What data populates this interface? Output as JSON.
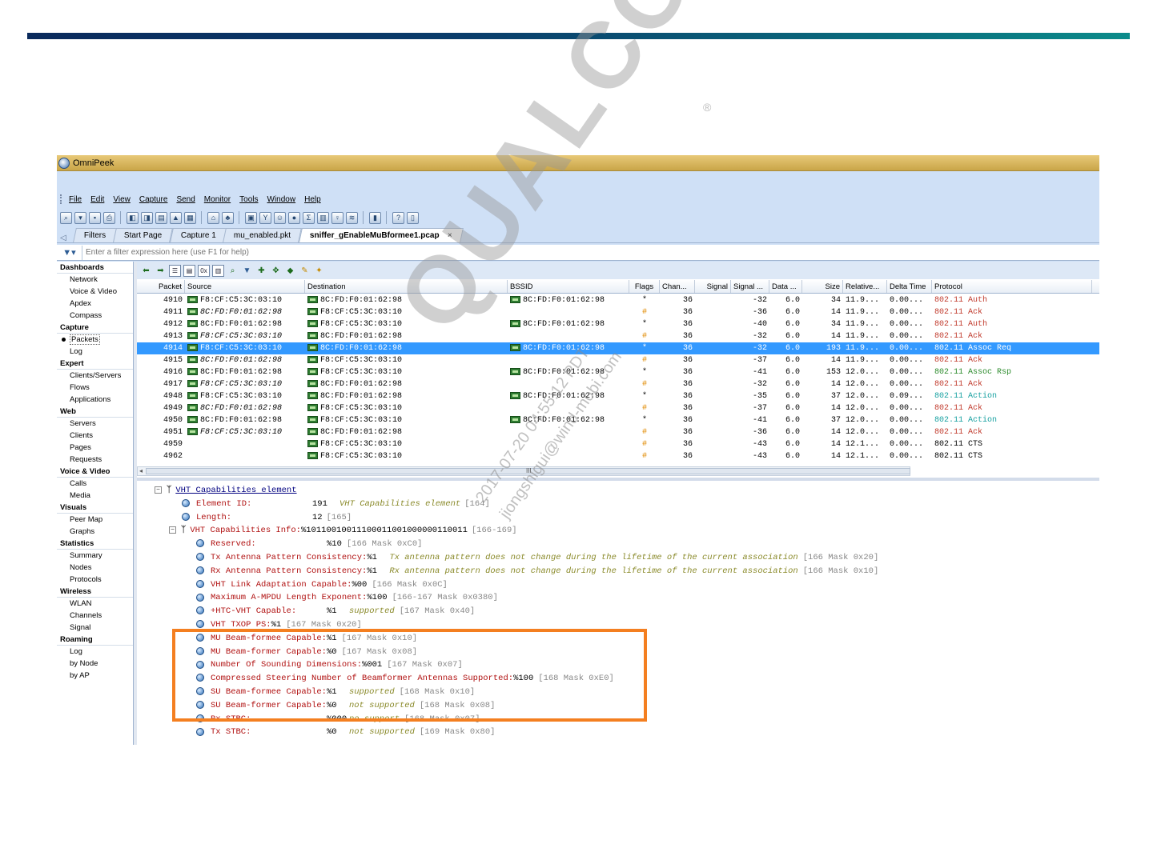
{
  "app": {
    "title": "OmniPeek"
  },
  "menu": [
    "File",
    "Edit",
    "View",
    "Capture",
    "Send",
    "Monitor",
    "Tools",
    "Window",
    "Help"
  ],
  "tabs": [
    {
      "label": "Filters"
    },
    {
      "label": "Start Page"
    },
    {
      "label": "Capture 1"
    },
    {
      "label": "mu_enabled.pkt"
    },
    {
      "label": "sniffer_gEnableMuBformee1.pcap",
      "active": true,
      "close": "×"
    }
  ],
  "filter": {
    "placeholder": "Enter a filter expression here (use F1 for help)"
  },
  "sidebar": {
    "groups": [
      {
        "label": "Dashboards",
        "items": [
          "Network",
          "Voice & Video",
          "Apdex",
          "Compass"
        ]
      },
      {
        "label": "Capture",
        "items": [
          "Packets",
          "Log"
        ],
        "selected": "Packets"
      },
      {
        "label": "Expert",
        "items": [
          "Clients/Servers",
          "Flows",
          "Applications"
        ]
      },
      {
        "label": "Web",
        "items": [
          "Servers",
          "Clients",
          "Pages",
          "Requests"
        ]
      },
      {
        "label": "Voice & Video",
        "items": [
          "Calls",
          "Media"
        ]
      },
      {
        "label": "Visuals",
        "items": [
          "Peer Map",
          "Graphs"
        ]
      },
      {
        "label": "Statistics",
        "items": [
          "Summary",
          "Nodes",
          "Protocols"
        ]
      },
      {
        "label": "Wireless",
        "items": [
          "WLAN",
          "Channels",
          "Signal"
        ]
      },
      {
        "label": "Roaming",
        "items": [
          "Log",
          "by Node",
          "by AP"
        ]
      }
    ]
  },
  "packets": {
    "columns": [
      "Packet",
      "Source",
      "Destination",
      "BSSID",
      "Flags",
      "Chan...",
      "Signal",
      "Signal ...",
      "Data ...",
      "Size",
      "Relative...",
      "Delta Time",
      "Protocol"
    ],
    "rows": [
      {
        "packet": "4910",
        "source": "F8:CF:C5:3C:03:10",
        "src_it": false,
        "dest": "8C:FD:F0:01:62:98",
        "dest_it": false,
        "bssid": "8C:FD:F0:01:62:98",
        "flags": "*",
        "chan": "36",
        "signal": "",
        "signal_dbm": "-32",
        "data": "6.0",
        "size": "34",
        "rel": "11.9...",
        "delta": "0.00...",
        "protocol": "802.11 Auth",
        "ptype": "auth"
      },
      {
        "packet": "4911",
        "source": "8C:FD:F0:01:62:98",
        "src_it": true,
        "dest": "F8:CF:C5:3C:03:10",
        "dest_it": false,
        "bssid": "",
        "flags": "#",
        "chan": "36",
        "signal": "",
        "signal_dbm": "-36",
        "data": "6.0",
        "size": "14",
        "rel": "11.9...",
        "delta": "0.00...",
        "protocol": "802.11 Ack",
        "ptype": "ack"
      },
      {
        "packet": "4912",
        "source": "8C:FD:F0:01:62:98",
        "src_it": false,
        "dest": "F8:CF:C5:3C:03:10",
        "dest_it": false,
        "bssid": "8C:FD:F0:01:62:98",
        "flags": "*",
        "chan": "36",
        "signal": "",
        "signal_dbm": "-40",
        "data": "6.0",
        "size": "34",
        "rel": "11.9...",
        "delta": "0.00...",
        "protocol": "802.11 Auth",
        "ptype": "auth"
      },
      {
        "packet": "4913",
        "source": "F8:CF:C5:3C:03:10",
        "src_it": true,
        "dest": "8C:FD:F0:01:62:98",
        "dest_it": false,
        "bssid": "",
        "flags": "#",
        "chan": "36",
        "signal": "",
        "signal_dbm": "-32",
        "data": "6.0",
        "size": "14",
        "rel": "11.9...",
        "delta": "0.00...",
        "protocol": "802.11 Ack",
        "ptype": "ack"
      },
      {
        "packet": "4914",
        "source": "F8:CF:C5:3C:03:10",
        "src_it": false,
        "dest": "8C:FD:F0:01:62:98",
        "dest_it": false,
        "bssid": "8C:FD:F0:01:62:98",
        "flags": "*",
        "chan": "36",
        "signal": "",
        "signal_dbm": "-32",
        "data": "6.0",
        "size": "193",
        "rel": "11.9...",
        "delta": "0.00...",
        "protocol": "802.11 Assoc Req",
        "ptype": "assoc",
        "selected": true
      },
      {
        "packet": "4915",
        "source": "8C:FD:F0:01:62:98",
        "src_it": true,
        "dest": "F8:CF:C5:3C:03:10",
        "dest_it": false,
        "bssid": "",
        "flags": "#",
        "chan": "36",
        "signal": "",
        "signal_dbm": "-37",
        "data": "6.0",
        "size": "14",
        "rel": "11.9...",
        "delta": "0.00...",
        "protocol": "802.11 Ack",
        "ptype": "ack"
      },
      {
        "packet": "4916",
        "source": "8C:FD:F0:01:62:98",
        "src_it": false,
        "dest": "F8:CF:C5:3C:03:10",
        "dest_it": false,
        "bssid": "8C:FD:F0:01:62:98",
        "flags": "*",
        "chan": "36",
        "signal": "",
        "signal_dbm": "-41",
        "data": "6.0",
        "size": "153",
        "rel": "12.0...",
        "delta": "0.00...",
        "protocol": "802.11 Assoc Rsp",
        "ptype": "assoc"
      },
      {
        "packet": "4917",
        "source": "F8:CF:C5:3C:03:10",
        "src_it": true,
        "dest": "8C:FD:F0:01:62:98",
        "dest_it": false,
        "bssid": "",
        "flags": "#",
        "chan": "36",
        "signal": "",
        "signal_dbm": "-32",
        "data": "6.0",
        "size": "14",
        "rel": "12.0...",
        "delta": "0.00...",
        "protocol": "802.11 Ack",
        "ptype": "ack"
      },
      {
        "packet": "4948",
        "source": "F8:CF:C5:3C:03:10",
        "src_it": false,
        "dest": "8C:FD:F0:01:62:98",
        "dest_it": false,
        "bssid": "8C:FD:F0:01:62:98",
        "flags": "*",
        "chan": "36",
        "signal": "",
        "signal_dbm": "-35",
        "data": "6.0",
        "size": "37",
        "rel": "12.0...",
        "delta": "0.09...",
        "protocol": "802.11 Action",
        "ptype": "action"
      },
      {
        "packet": "4949",
        "source": "8C:FD:F0:01:62:98",
        "src_it": true,
        "dest": "F8:CF:C5:3C:03:10",
        "dest_it": false,
        "bssid": "",
        "flags": "#",
        "chan": "36",
        "signal": "",
        "signal_dbm": "-37",
        "data": "6.0",
        "size": "14",
        "rel": "12.0...",
        "delta": "0.00...",
        "protocol": "802.11 Ack",
        "ptype": "ack"
      },
      {
        "packet": "4950",
        "source": "8C:FD:F0:01:62:98",
        "src_it": false,
        "dest": "F8:CF:C5:3C:03:10",
        "dest_it": false,
        "bssid": "8C:FD:F0:01:62:98",
        "flags": "*",
        "chan": "36",
        "signal": "",
        "signal_dbm": "-41",
        "data": "6.0",
        "size": "37",
        "rel": "12.0...",
        "delta": "0.00...",
        "protocol": "802.11 Action",
        "ptype": "action"
      },
      {
        "packet": "4951",
        "source": "F8:CF:C5:3C:03:10",
        "src_it": true,
        "dest": "8C:FD:F0:01:62:98",
        "dest_it": false,
        "bssid": "",
        "flags": "#",
        "chan": "36",
        "signal": "",
        "signal_dbm": "-36",
        "data": "6.0",
        "size": "14",
        "rel": "12.0...",
        "delta": "0.00...",
        "protocol": "802.11 Ack",
        "ptype": "ack"
      },
      {
        "packet": "4959",
        "source": "",
        "src_it": false,
        "dest": "F8:CF:C5:3C:03:10",
        "dest_it": false,
        "bssid": "",
        "flags": "#",
        "chan": "36",
        "signal": "",
        "signal_dbm": "-43",
        "data": "6.0",
        "size": "14",
        "rel": "12.1...",
        "delta": "0.00...",
        "protocol": "802.11 CTS",
        "ptype": "cts"
      },
      {
        "packet": "4962",
        "source": "",
        "src_it": false,
        "dest": "F8:CF:C5:3C:03:10",
        "dest_it": false,
        "bssid": "",
        "flags": "#",
        "chan": "36",
        "signal": "",
        "signal_dbm": "-43",
        "data": "6.0",
        "size": "14",
        "rel": "12.1...",
        "delta": "0.00...",
        "protocol": "802.11 CTS",
        "ptype": "cts"
      }
    ]
  },
  "scroll_grip": "III",
  "detail": {
    "header": "VHT Capabilities element",
    "element_id": {
      "label": "Element ID:",
      "value": "191",
      "desc": "VHT Capabilities element",
      "mask": "[164]"
    },
    "length": {
      "label": "Length:",
      "value": "12",
      "mask": "[165]"
    },
    "info": {
      "label": "VHT Capabilities Info:",
      "value": "%10110010011100011001000000110011",
      "mask": "[166-169]"
    },
    "fields": [
      {
        "label": "Reserved:",
        "value": "%10",
        "desc": "",
        "mask": "[166 Mask 0xC0]"
      },
      {
        "label": "Tx Antenna Pattern Consistency:",
        "value": "%1",
        "desc": "Tx antenna pattern does not change during the lifetime of the current association",
        "mask": "[166 Mask 0x20]"
      },
      {
        "label": "Rx Antenna Pattern Consistency:",
        "value": "%1",
        "desc": "Rx antenna pattern does not change during the lifetime of the current association",
        "mask": "[166 Mask 0x10]"
      },
      {
        "label": "VHT Link Adaptation Capable:",
        "value": "%00",
        "desc": "",
        "mask": "[166 Mask 0x0C]"
      },
      {
        "label": "Maximum A-MPDU Length Exponent:",
        "value": "%100",
        "desc": "",
        "mask": "[166-167 Mask 0x0380]"
      },
      {
        "label": "+HTC-VHT Capable:",
        "value": "%1",
        "desc": "supported",
        "mask": "[167 Mask 0x40]"
      },
      {
        "label": "VHT TXOP PS:",
        "value": "%1",
        "desc": "",
        "mask": "[167 Mask 0x20]"
      },
      {
        "label": "MU Beam-formee Capable:",
        "value": "%1",
        "desc": "",
        "mask": "[167 Mask 0x10]"
      },
      {
        "label": "MU Beam-former Capable:",
        "value": "%0",
        "desc": "",
        "mask": "[167 Mask 0x08]"
      },
      {
        "label": "Number Of Sounding Dimensions:",
        "value": "%001",
        "desc": "",
        "mask": "[167 Mask 0x07]"
      },
      {
        "label": "Compressed Steering Number of Beamformer Antennas Supported:",
        "value": "%100",
        "desc": "",
        "mask": "[168 Mask 0xE0]"
      },
      {
        "label": "SU Beam-formee Capable:",
        "value": "%1",
        "desc": "supported",
        "mask": "[168 Mask 0x10]"
      },
      {
        "label": "SU Beam-former Capable:",
        "value": "%0",
        "desc": "not supported",
        "mask": "[168 Mask 0x08]"
      },
      {
        "label": "Rx STBC:",
        "value": "%000",
        "desc": "no support",
        "mask": "[168 Mask 0x07]"
      },
      {
        "label": "Tx STBC:",
        "value": "%0",
        "desc": "not supported",
        "mask": "[169 Mask 0x80]"
      }
    ]
  },
  "watermark": {
    "brand": "QUALCOMM",
    "line1": "2017-07-20 04:55:12 PDT",
    "line2": "jiongshigui@wind-mobi.com",
    "reg": "®"
  },
  "colors": {
    "accent_bar": "#0a6f7e",
    "title_gold": "#d8b860",
    "selection": "#3399ff",
    "highlight_box": "#f47f20"
  }
}
